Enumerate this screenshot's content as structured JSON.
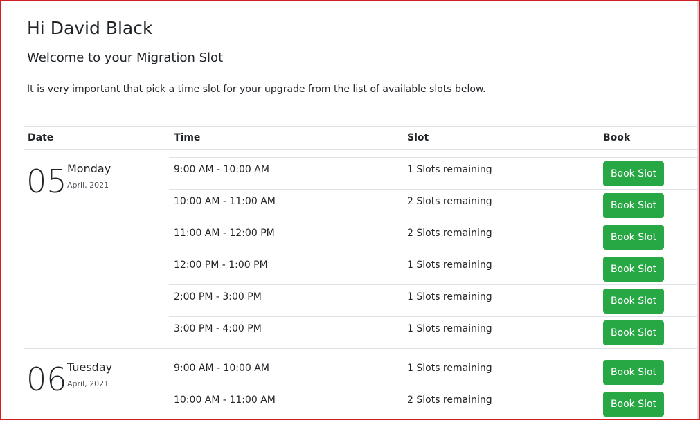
{
  "header": {
    "greeting": "Hi David Black",
    "welcome": "Welcome to your Migration Slot",
    "intro": "It is very important that pick a time slot for your upgrade from the list of available slots below."
  },
  "table": {
    "headers": {
      "date": "Date",
      "time": "Time",
      "slot": "Slot",
      "book": "Book"
    }
  },
  "days": [
    {
      "day_num": "05",
      "weekday": "Monday",
      "month_year": "April, 2021",
      "slots": [
        {
          "time": "9:00 AM - 10:00 AM",
          "remaining": "1 Slots remaining",
          "button": "Book Slot"
        },
        {
          "time": "10:00 AM - 11:00 AM",
          "remaining": "2 Slots remaining",
          "button": "Book Slot"
        },
        {
          "time": "11:00 AM - 12:00 PM",
          "remaining": "2 Slots remaining",
          "button": "Book Slot"
        },
        {
          "time": "12:00 PM - 1:00 PM",
          "remaining": "1 Slots remaining",
          "button": "Book Slot"
        },
        {
          "time": "2:00 PM - 3:00 PM",
          "remaining": "1 Slots remaining",
          "button": "Book Slot"
        },
        {
          "time": "3:00 PM - 4:00 PM",
          "remaining": "1 Slots remaining",
          "button": "Book Slot"
        }
      ]
    },
    {
      "day_num": "06",
      "weekday": "Tuesday",
      "month_year": "April, 2021",
      "slots": [
        {
          "time": "9:00 AM - 10:00 AM",
          "remaining": "1 Slots remaining",
          "button": "Book Slot"
        },
        {
          "time": "10:00 AM - 11:00 AM",
          "remaining": "2 Slots remaining",
          "button": "Book Slot"
        }
      ]
    }
  ],
  "colors": {
    "button_bg": "#28a745",
    "frame_border": "#d21f24",
    "rule": "#dee2e6"
  }
}
